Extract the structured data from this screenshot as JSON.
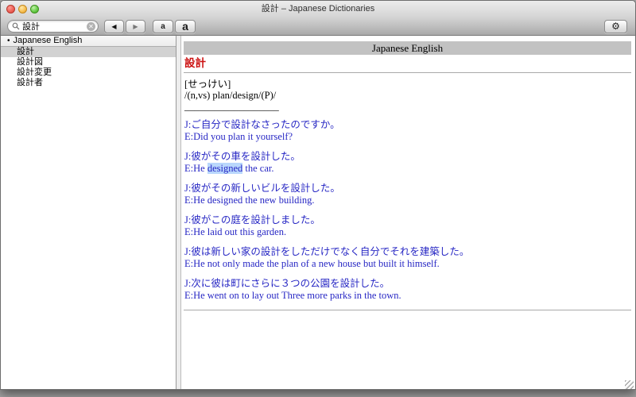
{
  "window": {
    "title": "設計 – Japanese Dictionaries"
  },
  "toolbar": {
    "search": {
      "value": "設計",
      "placeholder": "",
      "icon": "magnifier-icon",
      "clear_glyph": "✕"
    },
    "back_glyph": "◀",
    "forward_glyph": "▶",
    "font_smaller_label": "a",
    "font_larger_label": "a",
    "gear_glyph": "⚙"
  },
  "sidebar": {
    "header": {
      "bullet": "•",
      "label": "Japanese English"
    },
    "items": [
      {
        "label": "設計",
        "selected": true
      },
      {
        "label": "設計図",
        "selected": false
      },
      {
        "label": "設計変更",
        "selected": false
      },
      {
        "label": "設計者",
        "selected": false
      }
    ]
  },
  "content": {
    "dictionary_header": "Japanese English",
    "entry_title": "設計",
    "reading": "[せっけい]",
    "definition": "/(n,vs) plan/design/(P)/",
    "separator": "___________________",
    "examples": [
      {
        "j": "J:ご自分で設計なさったのですか。",
        "e": "E:Did you plan it yourself?"
      },
      {
        "j": "J:彼がその車を設計した。",
        "e": "E:He designed the car.",
        "highlight": "designed"
      },
      {
        "j": "J:彼がその新しいビルを設計した。",
        "e": "E:He designed the new building."
      },
      {
        "j": "J:彼がこの庭を設計しました。",
        "e": "E:He laid out this garden."
      },
      {
        "j": "J:彼は新しい家の設計をしただけでなく自分でそれを建築した。",
        "e": "E:He not only made the plan of a new house but built it himself."
      },
      {
        "j": "J:次に彼は町にさらに３つの公園を設計した。",
        "e": "E:He went on to lay out Three more parks in the town."
      }
    ]
  },
  "colors": {
    "entry_title_red": "#cc1111",
    "example_blue": "#2727c4",
    "selection_highlight": "#b9d7fc",
    "sidebar_selection": "#d2d2d2",
    "dictionary_header_bg": "#c2c2c2",
    "desktop_bg": "#a7a7a7"
  }
}
